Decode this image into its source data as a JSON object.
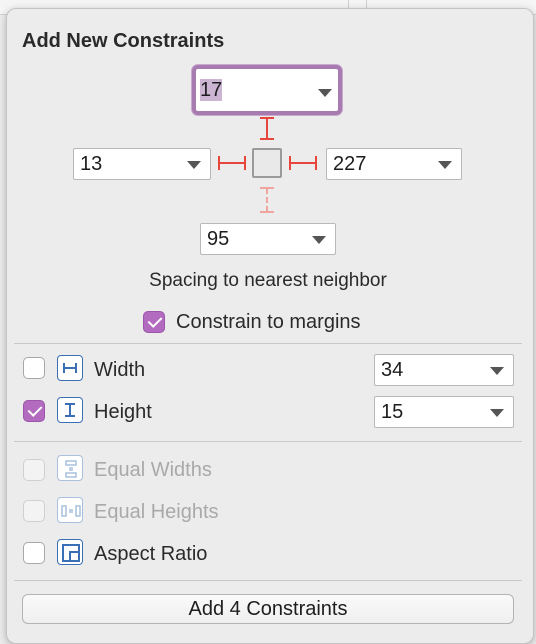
{
  "popover": {
    "title": "Add New Constraints",
    "spacing": {
      "top": "17",
      "left": "13",
      "right": "227",
      "bottom": "95",
      "caption": "Spacing to nearest neighbor"
    },
    "constrain_to_margins": {
      "label": "Constrain to margins",
      "checked": true
    },
    "size": {
      "width": {
        "label": "Width",
        "checked": false,
        "value": "34"
      },
      "height": {
        "label": "Height",
        "checked": true,
        "value": "15"
      }
    },
    "equal": {
      "widths": {
        "label": "Equal Widths",
        "checked": false,
        "enabled": false
      },
      "heights": {
        "label": "Equal Heights",
        "checked": false,
        "enabled": false
      },
      "aspect": {
        "label": "Aspect Ratio",
        "checked": false,
        "enabled": true
      }
    },
    "add_button": "Add 4 Constraints"
  },
  "colors": {
    "accent": "#b36bc0",
    "constraint_red": "#e8453c",
    "icon_blue": "#3a6fb5"
  },
  "icons": [
    "width-icon",
    "height-icon",
    "equal-widths-icon",
    "equal-heights-icon",
    "aspect-ratio-icon"
  ]
}
